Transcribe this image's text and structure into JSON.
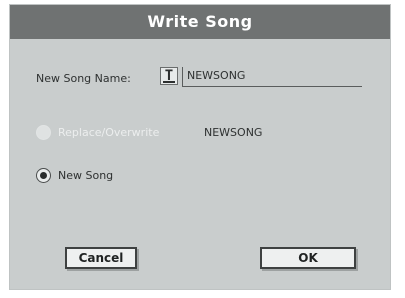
{
  "dialog": {
    "title": "Write Song",
    "name_label": "New Song Name:",
    "t_button_label": "T",
    "name_value": "NEWSONG",
    "options": {
      "replace_label": "Replace/Overwrite",
      "replace_value": "NEWSONG",
      "new_song_label": "New Song",
      "selected": "New Song"
    },
    "buttons": {
      "cancel_label": "Cancel",
      "ok_label": "OK"
    }
  }
}
